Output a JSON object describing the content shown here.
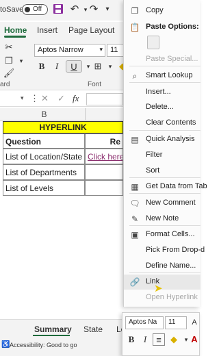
{
  "titlebar": {
    "autosave_label": "toSave",
    "autosave_state": "Off"
  },
  "ribbon": {
    "tabs": [
      {
        "label": "Home"
      },
      {
        "label": "Insert"
      },
      {
        "label": "Page Layout"
      }
    ],
    "font_name": "Aptos Narrow",
    "font_size": "11",
    "font_group_label": "Font",
    "clipboard_group_label": "ard"
  },
  "formula_bar": {
    "fx_label": "fx"
  },
  "sheet": {
    "column_b": "B",
    "header": "HYPERLINK",
    "col_question": "Question",
    "col_r": "Re",
    "rows": [
      {
        "question": "List of Location/State",
        "link": "Click here"
      },
      {
        "question": "List of Departments",
        "link": ""
      },
      {
        "question": "List of Levels",
        "link": ""
      }
    ],
    "tabs": [
      "Summary",
      "State",
      "Le"
    ],
    "status": "Accessibility: Good to go"
  },
  "context_menu": {
    "copy": "Copy",
    "paste_options": "Paste Options:",
    "paste_special": "Paste Special...",
    "smart_lookup": "Smart Lookup",
    "insert": "Insert...",
    "delete": "Delete...",
    "clear_contents": "Clear Contents",
    "quick_analysis": "Quick Analysis",
    "filter": "Filter",
    "sort": "Sort",
    "get_data": "Get Data from Tab",
    "new_comment": "New Comment",
    "new_note": "New Note",
    "format_cells": "Format Cells...",
    "pick_dropdown": "Pick From Drop-d",
    "define_name": "Define Name...",
    "link": "Link",
    "open_hyperlink": "Open Hyperlink"
  },
  "mini_toolbar": {
    "font_name": "Aptos Na",
    "font_size": "11"
  },
  "colors": {
    "accent": "#1e6b3c",
    "header_fill": "#ffff00",
    "link": "#8b2e6e"
  }
}
